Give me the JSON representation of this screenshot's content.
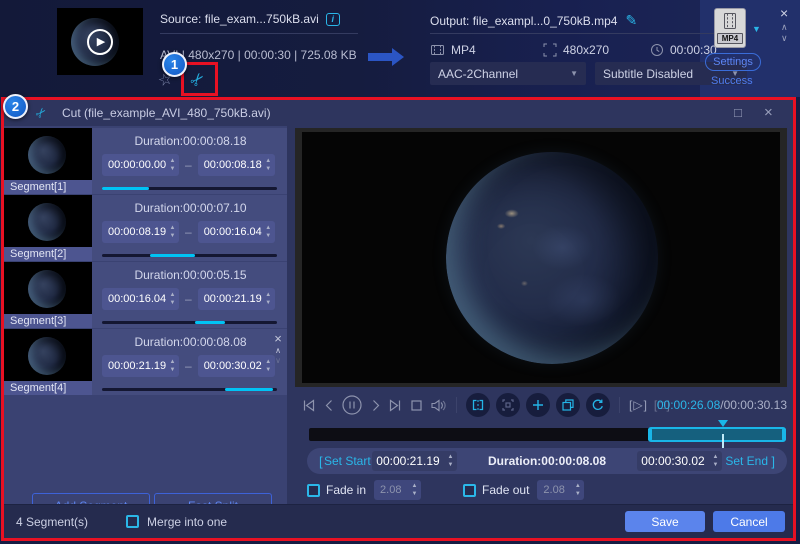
{
  "colors": {
    "accent_cyan": "#2ab6e8",
    "annotation_red": "#e81123",
    "badge_blue": "#1565d6",
    "button_blue": "#4d7ae8",
    "link_blue": "#5e86f2"
  },
  "icons": {
    "scissors": "✂",
    "pencil": "✎",
    "info": "i",
    "dropdown": "▼",
    "close": "×",
    "chevron_up": "∧",
    "chevron_down": "∨",
    "maximize": "□",
    "wand": "☆",
    "play": "▶",
    "bracket_play": "[▷]",
    "bracket_stop": "[□]",
    "dash": "–",
    "spin_up": "▲",
    "spin_down": "▼",
    "delete": "×"
  },
  "topbar": {
    "source": {
      "label": "Source: file_exam...750kB.avi",
      "meta": "AVI | 480x270 | 00:00:30 | 725.08 KB"
    },
    "output": {
      "label": "Output: file_exampl...0_750kB.mp4",
      "format": "MP4",
      "resolution": "480x270",
      "duration": "00:00:30",
      "audio_select": "AAC-2Channel",
      "subtitle_select": "Subtitle Disabled"
    },
    "format_badge": "MP4",
    "settings_button": "Settings",
    "status": "Success",
    "annotation_1": "1"
  },
  "dialog": {
    "annotation_2": "2",
    "title": "Cut (file_example_AVI_480_750kB.avi)",
    "segments": [
      {
        "label": "Segment[1]",
        "duration": "Duration:00:00:08.18",
        "start": "00:00:00.00",
        "end": "00:00:08.18",
        "bar_left": "0%",
        "bar_width": "27%"
      },
      {
        "label": "Segment[2]",
        "duration": "Duration:00:00:07.10",
        "start": "00:00:08.19",
        "end": "00:00:16.04",
        "bar_left": "27.2%",
        "bar_width": "26%"
      },
      {
        "label": "Segment[3]",
        "duration": "Duration:00:00:05.15",
        "start": "00:00:16.04",
        "end": "00:00:21.19",
        "bar_left": "53.3%",
        "bar_width": "17%"
      },
      {
        "label": "Segment[4]",
        "duration": "Duration:00:00:08.08",
        "start": "00:00:21.19",
        "end": "00:00:30.02",
        "bar_left": "70.3%",
        "bar_width": "27.5%"
      }
    ],
    "add_segment_button": "Add Segment",
    "fast_split_button": "Fast Split",
    "player": {
      "time_current": "00:00:26.08",
      "time_separator": "/",
      "time_total": "00:00:30.13",
      "selection_left": "71%",
      "selection_width": "29%",
      "playhead_left": "86.8%"
    },
    "trim": {
      "bracket_open": "[",
      "set_start": "Set Start",
      "start_value": "00:00:21.19",
      "duration_label": "Duration:00:00:08.08",
      "end_value": "00:00:30.02",
      "set_end": "Set End",
      "bracket_close": "]"
    },
    "fade": {
      "fade_in_label": "Fade in",
      "fade_in_value": "2.08",
      "fade_out_label": "Fade out",
      "fade_out_value": "2.08"
    },
    "footer": {
      "segment_count": "4 Segment(s)",
      "merge_label": "Merge into one",
      "save_button": "Save",
      "cancel_button": "Cancel"
    }
  }
}
